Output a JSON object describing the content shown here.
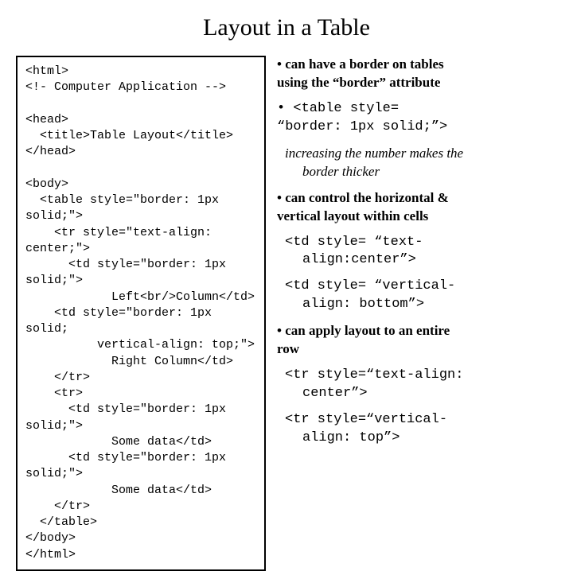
{
  "title": "Layout in a Table",
  "code": "<html>\n<!- Computer Application -->\n\n<head>\n  <title>Table Layout</title>\n</head>\n\n<body>\n  <table style=\"border: 1px solid;\">\n    <tr style=\"text-align: center;\">\n      <td style=\"border: 1px solid;\">\n            Left<br/>Column</td>\n    <td style=\"border: 1px solid;\n          vertical-align: top;\">\n            Right Column</td>\n    </tr>\n    <tr>\n      <td style=\"border: 1px solid;\">\n            Some data</td>\n      <td style=\"border: 1px solid;\">\n            Some data</td>\n    </tr>\n  </table>\n</body>\n</html>",
  "right": {
    "b1_line1": "• can have a border on tables",
    "b1_line2": "using the “border” attribute",
    "code1_line1": "•  <table style=",
    "code1_line2": "“border: 1px solid;”>",
    "ital_line1": "increasing the number makes the",
    "ital_line2": "border thicker",
    "b2_line1": "• can control the horizontal &",
    "b2_line2": "vertical layout within cells",
    "code2_line1": "<td style= “text-",
    "code2_line2": "align:center”>",
    "code3_line1": "<td style= “vertical-",
    "code3_line2": "align: bottom”>",
    "b3_line1": "• can apply layout to an entire",
    "b3_line2": "row",
    "code4_line1": "<tr style=“text-align:",
    "code4_line2": "center”>",
    "code5_line1": "<tr style=“vertical-",
    "code5_line2": "align: top”>"
  }
}
